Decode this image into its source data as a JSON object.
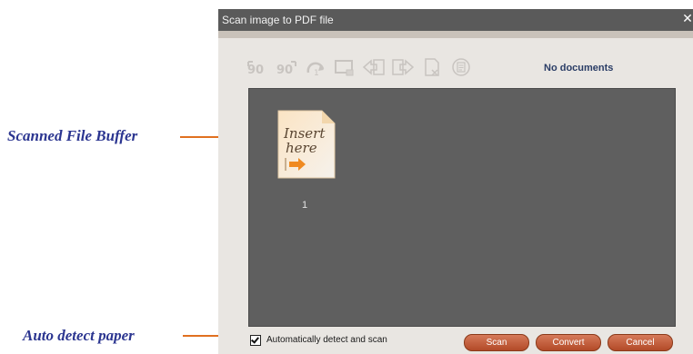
{
  "annotations": {
    "buffer_label": "Scanned File Buffer",
    "auto_label": "Auto detect paper",
    "line_color": "#e07020"
  },
  "window": {
    "title": "Scan image to PDF file",
    "close_glyph": "✕"
  },
  "toolbar": {
    "icons": [
      "rotate-left-90-icon",
      "rotate-right-90-icon",
      "rotate-180-icon",
      "crop-icon",
      "move-page-left-icon",
      "move-page-right-icon",
      "delete-page-icon",
      "properties-icon"
    ],
    "status": "No documents"
  },
  "buffer": {
    "pages": [
      {
        "number": "1",
        "thumbnail_text": "Insert here",
        "icon": "insert-here-page-icon"
      }
    ]
  },
  "footer": {
    "auto_detect_label": "Automatically detect and scan",
    "auto_detect_checked": true,
    "scan_label": "Scan",
    "convert_label": "Convert",
    "cancel_label": "Cancel"
  },
  "colors": {
    "titlebar": "#5a5a5a",
    "buffer_bg": "#5f5f5f",
    "button": "#c25a36",
    "annotation_text": "#2b3590"
  }
}
